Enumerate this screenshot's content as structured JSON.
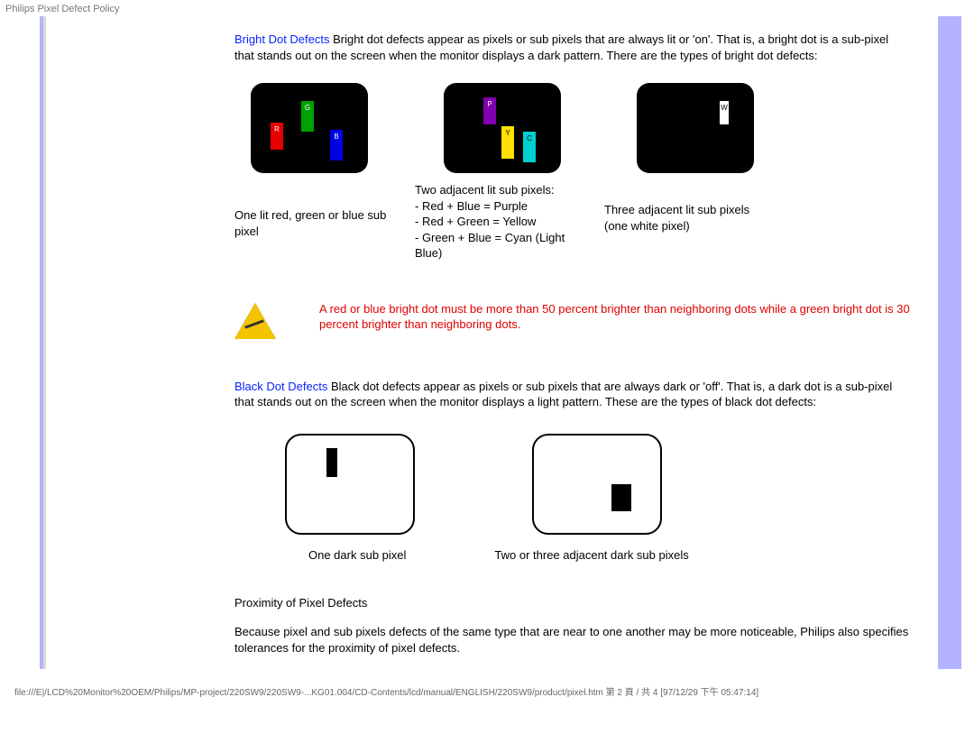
{
  "header": {
    "title": "Philips Pixel Defect Policy"
  },
  "bright": {
    "term": "Bright Dot Defects",
    "body": " Bright dot defects appear as pixels or sub pixels that are always lit or 'on'. That is, a bright dot is a sub-pixel that stands out on the screen when the monitor displays a dark pattern. There are the types of bright dot defects:",
    "diagram1": {
      "r": "R",
      "g": "G",
      "b": "B"
    },
    "diagram2": {
      "p": "P",
      "y": "Y",
      "c": "C"
    },
    "diagram3": {
      "w": "W"
    },
    "cap1": "One lit red, green or blue sub pixel",
    "cap2_line1": "Two adjacent lit sub pixels:",
    "cap2_line2": "- Red + Blue = Purple",
    "cap2_line3": "- Red + Green = Yellow",
    "cap2_line4": "- Green + Blue = Cyan (Light Blue)",
    "cap3_line1": "Three adjacent lit sub pixels",
    "cap3_line2": "(one white pixel)"
  },
  "warning": {
    "text": "A red or blue bright dot must be more than 50 percent brighter than neighboring dots while a green bright dot is 30 percent brighter than neighboring dots."
  },
  "black": {
    "term": "Black Dot Defects",
    "body": " Black dot defects appear as pixels or sub pixels that are always dark or 'off'. That is, a dark dot is a sub-pixel that stands out on the screen when the monitor displays a light pattern. These are the types of black dot defects:",
    "cap1": "One dark sub pixel",
    "cap2": "Two or three adjacent dark sub pixels"
  },
  "proximity": {
    "heading": "Proximity of Pixel Defects",
    "body": "Because pixel and sub pixels defects of the same type that are near to one another may be more noticeable, Philips also specifies tolerances for the proximity of pixel defects."
  },
  "footer": {
    "path": "file:///E|/LCD%20Monitor%20OEM/Philips/MP-project/220SW9/220SW9-...KG01.004/CD-Contents/lcd/manual/ENGLISH/220SW9/product/pixel.htm 第 2 頁 / 共 4 [97/12/29 下午 05:47:14]"
  }
}
